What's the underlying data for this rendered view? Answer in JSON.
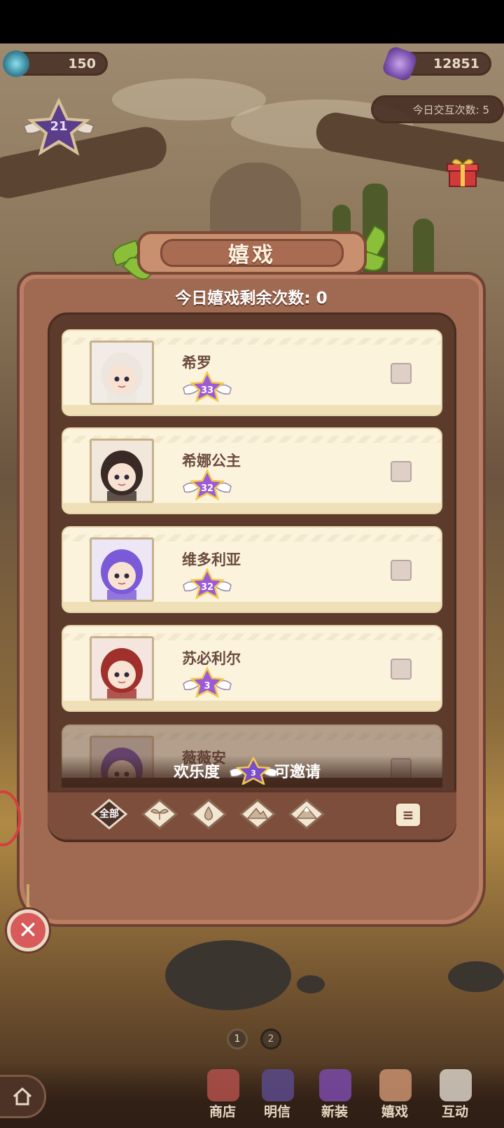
{
  "top_bar": {
    "left_currency": "150",
    "right_currency": "12851",
    "level": "21",
    "daily_interactions": "今日交互次数: 5"
  },
  "panel": {
    "title": "嬉戏",
    "remaining": "今日嬉戏剩余次数: 0",
    "characters": [
      {
        "name": "希罗",
        "level": "33",
        "checked": false,
        "portrait_color": "#f1ede6",
        "hair": "#ece6de"
      },
      {
        "name": "希娜公主",
        "level": "32",
        "checked": false,
        "portrait_color": "#f1e7db",
        "hair": "#3a2a26"
      },
      {
        "name": "维多利亚",
        "level": "32",
        "checked": false,
        "portrait_color": "#ece6f5",
        "hair": "#7b5ad8"
      },
      {
        "name": "苏必利尔",
        "level": "3",
        "checked": false,
        "portrait_color": "#f4e6de",
        "hair": "#a0302c"
      },
      {
        "name": "薇薇安",
        "level": "",
        "checked": false,
        "portrait_color": "#d9cbc0",
        "hair": "#6a4aa0"
      }
    ],
    "invite": {
      "prefix": "欢乐度",
      "level": "3",
      "suffix": "可邀请"
    },
    "filters": {
      "all_label": "全部",
      "icons": [
        "sprout-filter-icon",
        "drop-filter-icon",
        "mountain-filter-icon",
        "snow-peak-filter-icon"
      ]
    },
    "sort_icon": "sort-icon"
  },
  "pages": [
    "1",
    "2"
  ],
  "nav": [
    {
      "label": "商店",
      "icon": "shop-icon"
    },
    {
      "label": "明信",
      "icon": "postcard-icon"
    },
    {
      "label": "新装",
      "icon": "outfit-icon"
    },
    {
      "label": "嬉戏",
      "icon": "play-icon"
    },
    {
      "label": "互动",
      "icon": "interact-icon"
    }
  ],
  "colors": {
    "panel": "#a06a52",
    "card": "#fbf3dc",
    "name": "#6a4a3e",
    "close": "#d85a5a"
  }
}
